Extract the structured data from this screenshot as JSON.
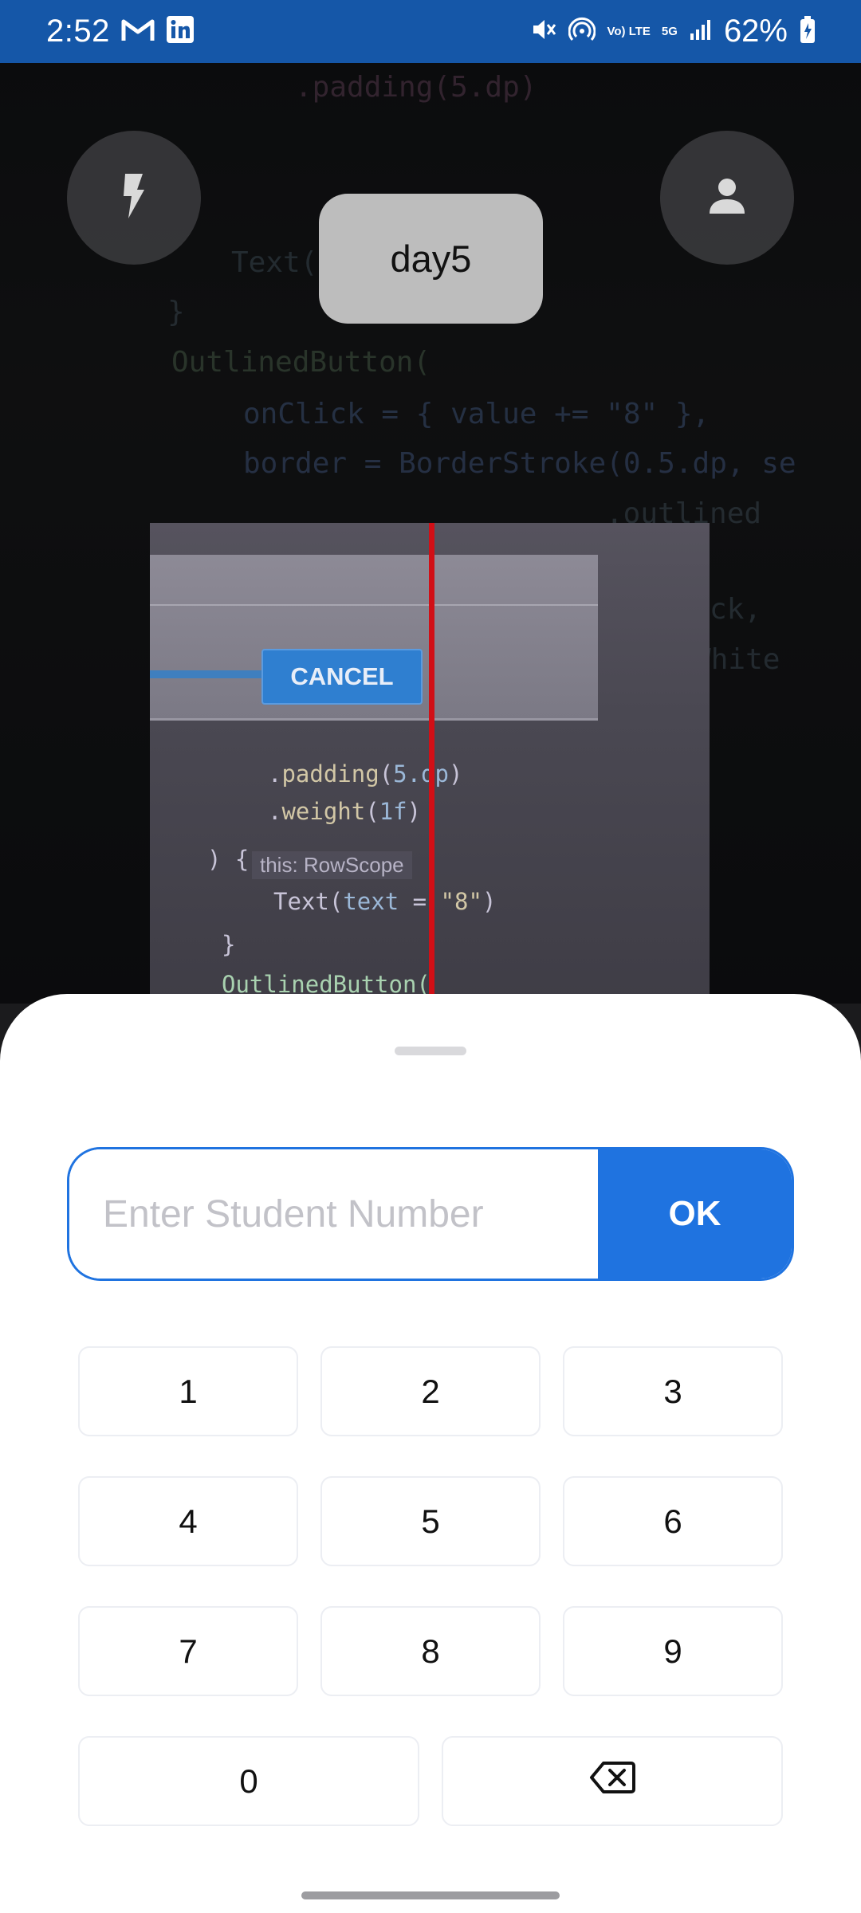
{
  "status_bar": {
    "time": "2:52",
    "battery": "62%",
    "network_volte": "Vo) LTE",
    "network_5g": "5G"
  },
  "camera": {
    "event_name": "day5",
    "flash_icon": "flash-icon",
    "account_icon": "person-icon",
    "captured_button_label": "CANCEL",
    "captured_hint": "this: RowScope",
    "accent_line_color": "#d10f16"
  },
  "sheet": {
    "input": {
      "placeholder": "Enter Student Number",
      "value": ""
    },
    "ok_label": "OK",
    "keys": [
      "1",
      "2",
      "3",
      "4",
      "5",
      "6",
      "7",
      "8",
      "9",
      "0"
    ],
    "backspace_icon": "backspace-icon",
    "accent_color": "#1f73e0"
  }
}
